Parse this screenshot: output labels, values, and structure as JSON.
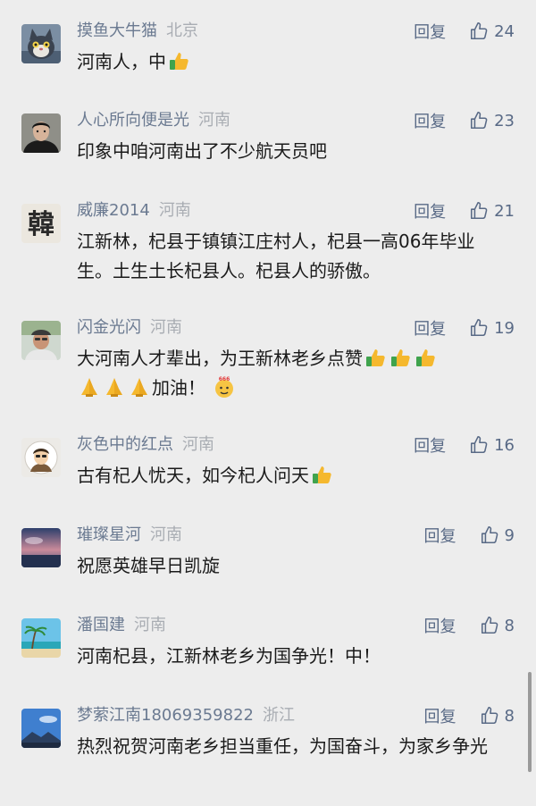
{
  "reply_label": "回复",
  "comments": [
    {
      "name": "摸鱼大牛猫",
      "location": "北京",
      "likes": "24",
      "text": "河南人，中",
      "avatar_icon": "cartoon-cat-avatar"
    },
    {
      "name": "人心所向便是光",
      "location": "河南",
      "likes": "23",
      "text": "印象中咱河南出了不少航天员吧",
      "avatar_icon": "man-portrait-avatar"
    },
    {
      "name": "威廉2014",
      "location": "河南",
      "likes": "21",
      "text": "江新林，杞县于镇镇江庄村人，杞县一高06年毕业生。土生土长杞县人。杞县人的骄傲。",
      "avatar_icon": "calligraphy-han-avatar",
      "avatar_char": "韓"
    },
    {
      "name": "闪金光闪",
      "location": "河南",
      "likes": "19",
      "text": "大河南人才辈出，为王新林老乡点赞",
      "text_line2": "加油！",
      "avatar_icon": "elderly-man-photo-avatar"
    },
    {
      "name": "灰色中的红点",
      "location": "河南",
      "likes": "16",
      "text": "古有杞人忧天，如今杞人问天",
      "avatar_icon": "cartoon-person-avatar"
    },
    {
      "name": "璀璨星河",
      "location": "河南",
      "likes": "9",
      "text": "祝愿英雄早日凯旋",
      "avatar_icon": "sunset-sky-avatar"
    },
    {
      "name": "潘国建",
      "location": "河南",
      "likes": "8",
      "text": "河南杞县，江新林老乡为国争光！中！",
      "avatar_icon": "beach-palm-avatar"
    },
    {
      "name": "梦萦江南18069359822",
      "location": "浙江",
      "likes": "8",
      "text": "热烈祝贺河南老乡担当重任，为国奋斗，为家乡争光",
      "avatar_icon": "blue-sky-landscape-avatar"
    }
  ],
  "emoji": {
    "six_label": "666"
  },
  "colors": {
    "name": "#6b7a91",
    "location": "#a9adb3",
    "action": "#596a86",
    "text": "#1a1a1a",
    "background": "#ededed"
  }
}
